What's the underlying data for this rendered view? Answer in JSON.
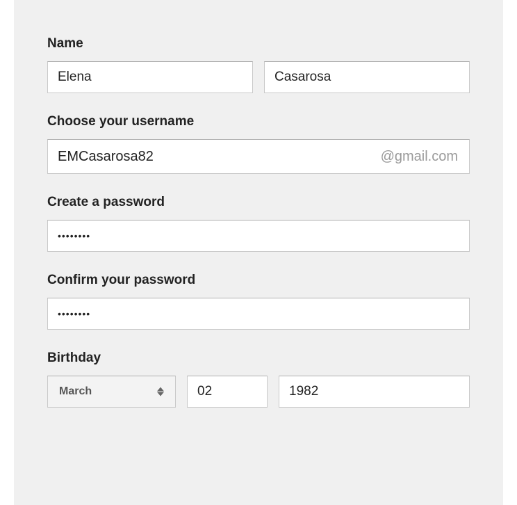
{
  "name": {
    "label": "Name",
    "first_name_value": "Elena",
    "last_name_value": "Casarosa"
  },
  "username": {
    "label": "Choose your username",
    "value": "EMCasarosa82",
    "suffix": "@gmail.com"
  },
  "password": {
    "label": "Create a password",
    "value": "••••••••"
  },
  "confirm_password": {
    "label": "Confirm your password",
    "value": "••••••••"
  },
  "birthday": {
    "label": "Birthday",
    "month_value": "March",
    "day_value": "02",
    "year_value": "1982"
  }
}
